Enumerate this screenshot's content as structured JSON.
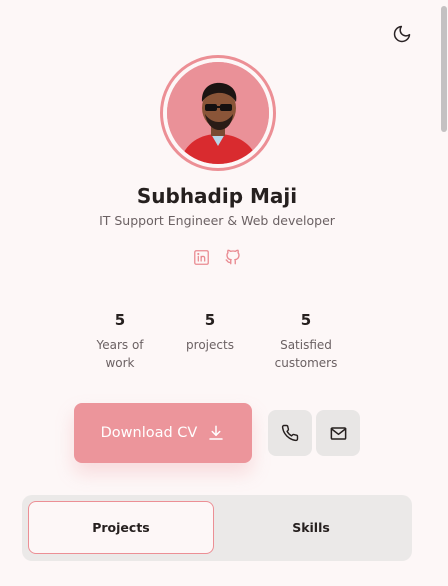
{
  "header": {
    "theme_icon": "moon-icon"
  },
  "profile": {
    "name": "Subhadip Maji",
    "role": "IT Support Engineer & Web developer",
    "avatar_bg": "#ea9198",
    "accent": "#ec8f95"
  },
  "socials": [
    {
      "icon": "linkedin-icon"
    },
    {
      "icon": "github-icon"
    }
  ],
  "stats": [
    {
      "value": "5",
      "label_line1": "Years of",
      "label_line2": "work"
    },
    {
      "value": "5",
      "label_line1": "projects",
      "label_line2": ""
    },
    {
      "value": "5",
      "label_line1": "Satisfied",
      "label_line2": "customers"
    }
  ],
  "actions": {
    "download_label": "Download CV",
    "download_icon": "download-icon",
    "phone_icon": "phone-icon",
    "mail_icon": "mail-icon"
  },
  "tabs": [
    {
      "label": "Projects",
      "active": true
    },
    {
      "label": "Skills",
      "active": false
    }
  ]
}
